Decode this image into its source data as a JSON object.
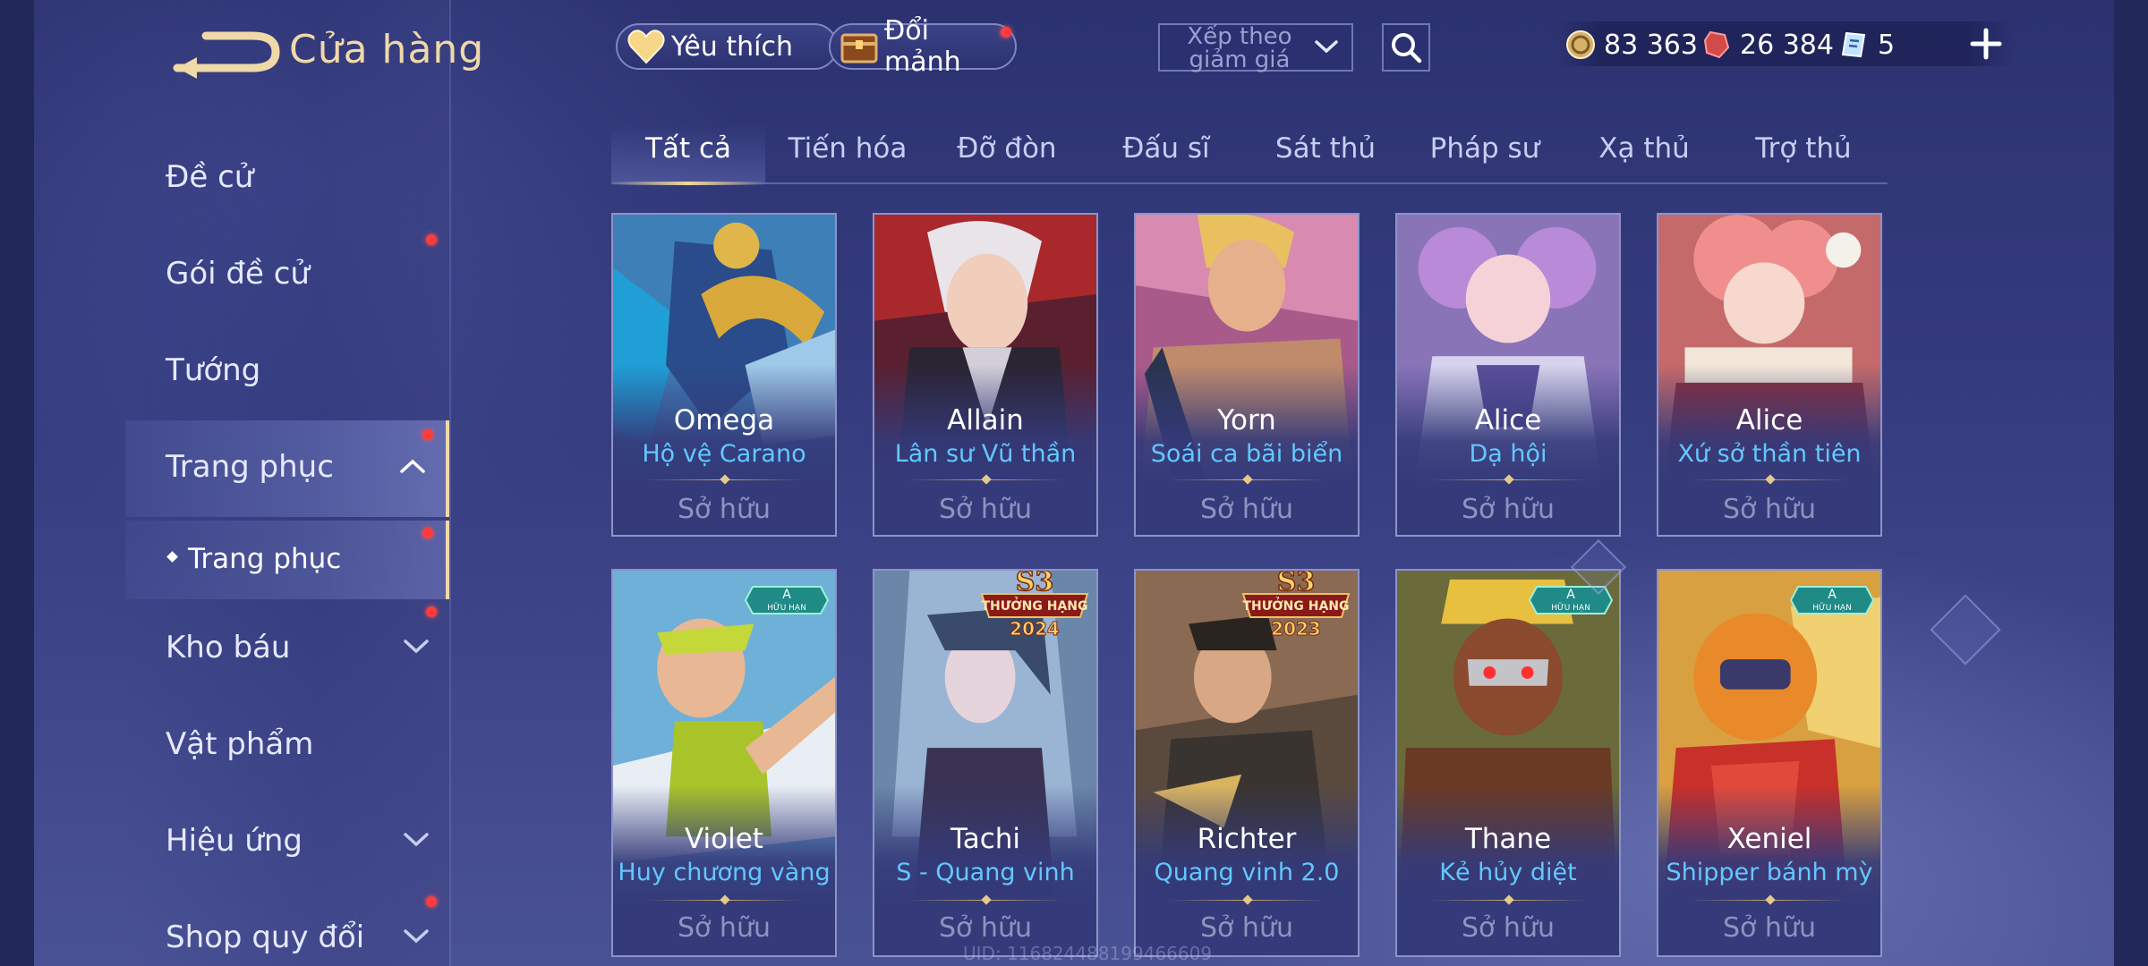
{
  "header": {
    "title": "Cửa hàng",
    "favorites_label": "Yêu thích",
    "exchange_label": "Đổi mảnh",
    "sort_label": "Xếp theo giảm giá"
  },
  "currency": {
    "gold": "83 363",
    "vouchers": "26 384",
    "tickets": "5"
  },
  "sidebar": {
    "items": [
      {
        "label": "Đề cử"
      },
      {
        "label": "Gói đề cử"
      },
      {
        "label": "Tướng"
      },
      {
        "label": "Trang phục"
      },
      {
        "label": "Kho báu"
      },
      {
        "label": "Vật phẩm"
      },
      {
        "label": "Hiệu ứng"
      },
      {
        "label": "Shop quy đổi"
      }
    ],
    "sub_item": "Trang phục"
  },
  "tabs": [
    "Tất cả",
    "Tiến hóa",
    "Đỡ đòn",
    "Đấu sĩ",
    "Sát thủ",
    "Pháp sư",
    "Xạ thủ",
    "Trợ thủ"
  ],
  "cards": [
    {
      "hero": "Omega",
      "skin": "Hộ vệ Carano",
      "status": "Sở hữu"
    },
    {
      "hero": "Allain",
      "skin": "Lân sư Vũ thần",
      "status": "Sở hữu"
    },
    {
      "hero": "Yorn",
      "skin": "Soái ca bãi biển",
      "status": "Sở hữu"
    },
    {
      "hero": "Alice",
      "skin": "Dạ hội",
      "status": "Sở hữu"
    },
    {
      "hero": "Alice",
      "skin": "Xứ sở thần tiên",
      "status": "Sở hữu"
    },
    {
      "hero": "Violet",
      "skin": "Huy chương vàng",
      "status": "Sở hữu"
    },
    {
      "hero": "Tachi",
      "skin": "S - Quang vinh",
      "status": "Sở hữu"
    },
    {
      "hero": "Richter",
      "skin": "Quang vinh 2.0",
      "status": "Sở hữu"
    },
    {
      "hero": "Thane",
      "skin": "Kẻ hủy diệt",
      "status": "Sở hữu"
    },
    {
      "hero": "Xeniel",
      "skin": "Shipper bánh mỳ",
      "status": "Sở hữu"
    }
  ],
  "badges": {
    "limited_letter": "A",
    "limited_text": "HỮU HẠN",
    "s3_label": "S3",
    "s3_rank": "THƯỞNG HẠNG",
    "year_2024": "2024",
    "year_2023": "2023"
  },
  "uid_text": "UID: 116824488199466609",
  "colors": {
    "accent_gold": "#f0d9a8",
    "skin_name_blue": "#63c7ff",
    "notify_red": "#ff3b3b"
  }
}
